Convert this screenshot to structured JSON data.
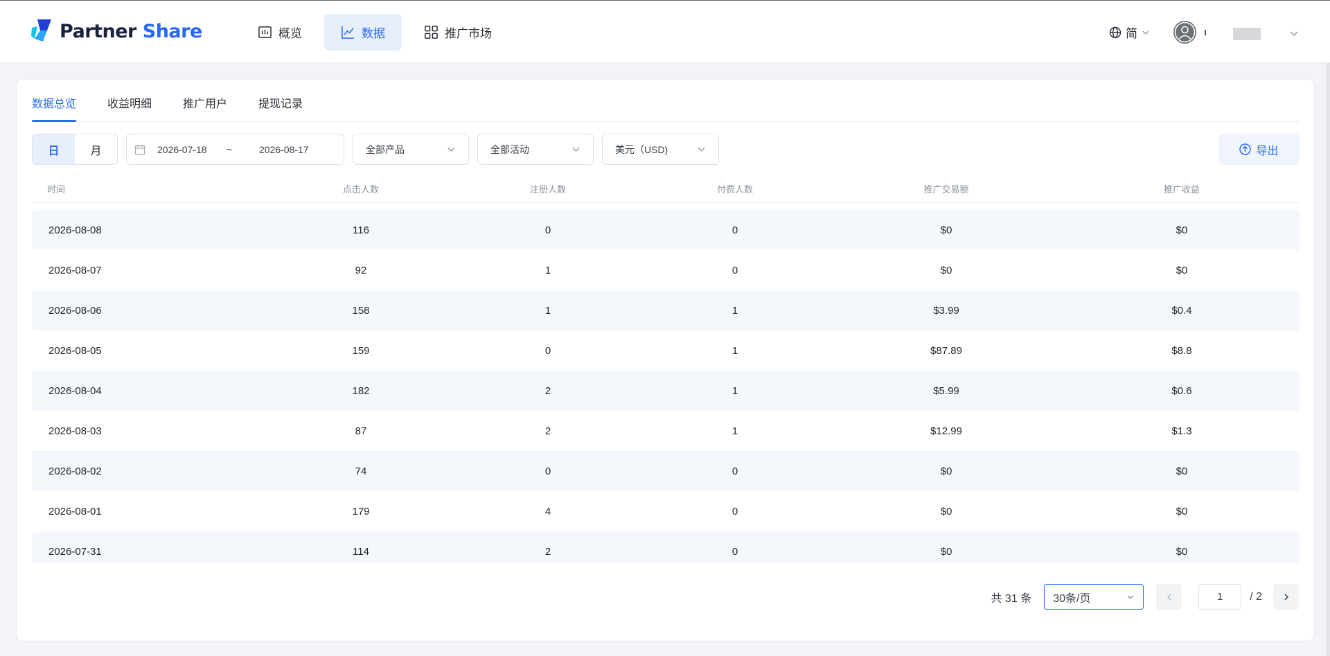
{
  "brand": {
    "part1": "Partner",
    "part2": "Share"
  },
  "nav": [
    {
      "label": "概览",
      "icon": "overview-icon"
    },
    {
      "label": "数据",
      "icon": "chart-line-icon",
      "active": true
    },
    {
      "label": "推广市场",
      "icon": "grid-icon"
    }
  ],
  "header": {
    "lang_label": "简"
  },
  "tabs": [
    {
      "label": "数据总览",
      "active": true
    },
    {
      "label": "收益明细"
    },
    {
      "label": "推广用户"
    },
    {
      "label": "提现记录"
    }
  ],
  "filters": {
    "granularity": [
      {
        "label": "日",
        "active": true
      },
      {
        "label": "月"
      }
    ],
    "date_start": "2026-07-18",
    "date_sep": "~",
    "date_end": "2026-08-17",
    "product": "全部产品",
    "activity": "全部活动",
    "currency": "美元（USD)",
    "export_label": "导出"
  },
  "table": {
    "columns": [
      "时间",
      "点击人数",
      "注册人数",
      "付费人数",
      "推广交易额",
      "推广收益"
    ],
    "rows": [
      [
        "2026-08-08",
        "116",
        "0",
        "0",
        "$0",
        "$0"
      ],
      [
        "2026-08-07",
        "92",
        "1",
        "0",
        "$0",
        "$0"
      ],
      [
        "2026-08-06",
        "158",
        "1",
        "1",
        "$3.99",
        "$0.4"
      ],
      [
        "2026-08-05",
        "159",
        "0",
        "1",
        "$87.89",
        "$8.8"
      ],
      [
        "2026-08-04",
        "182",
        "2",
        "1",
        "$5.99",
        "$0.6"
      ],
      [
        "2026-08-03",
        "87",
        "2",
        "1",
        "$12.99",
        "$1.3"
      ],
      [
        "2026-08-02",
        "74",
        "0",
        "0",
        "$0",
        "$0"
      ],
      [
        "2026-08-01",
        "179",
        "4",
        "0",
        "$0",
        "$0"
      ],
      [
        "2026-07-31",
        "114",
        "2",
        "0",
        "$0",
        "$0"
      ]
    ]
  },
  "pagination": {
    "total": "共 31 条",
    "page_size": "30条/页",
    "current_page": "1",
    "total_pages": "/ 2"
  },
  "colors": {
    "accent": "#2a6af0",
    "row_alt": "#f4f7fc"
  }
}
